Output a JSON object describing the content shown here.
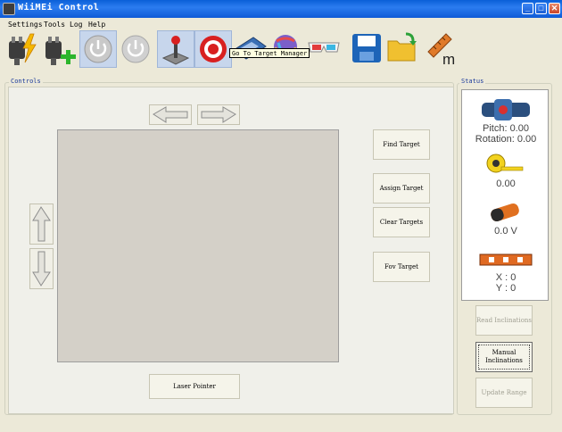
{
  "window": {
    "title": "WiiMEi Control",
    "minimize_glyph": "_",
    "maximize_glyph": "□",
    "close_glyph": "✕"
  },
  "menu": {
    "items": [
      {
        "label": "Settings"
      },
      {
        "label": "Tools"
      },
      {
        "label": "Log"
      },
      {
        "label": "Help"
      }
    ]
  },
  "toolbar": {
    "icons": [
      {
        "icon": "plug-disconnect-icon",
        "pressed": false
      },
      {
        "icon": "plug-connect-icon",
        "pressed": false
      },
      {
        "icon": "power-on-icon",
        "pressed": true
      },
      {
        "icon": "power-off-icon",
        "pressed": false
      },
      {
        "icon": "joystick-icon",
        "pressed": true
      },
      {
        "icon": "target-icon",
        "pressed": true
      },
      {
        "icon": "calculator-icon",
        "pressed": false
      },
      {
        "icon": "sphere-icon",
        "pressed": false
      },
      {
        "icon": "3d-glasses-icon",
        "pressed": false
      },
      {
        "icon": "save-icon",
        "pressed": false
      },
      {
        "icon": "open-folder-icon",
        "pressed": false
      },
      {
        "icon": "ruler-meters-icon",
        "pressed": false
      }
    ],
    "ruler_unit": "m",
    "tooltip": "Go To Target Manager"
  },
  "controls": {
    "group_label": "Controls",
    "find_target": "Find Target",
    "assign_target": "Assign Target",
    "clear_targets": "Clear Targets",
    "fov_target": "Fov Target",
    "laser_pointer": "Laser Pointer"
  },
  "status": {
    "group_label": "Status",
    "pitch": "Pitch: 0.00",
    "rotation": "Rotation: 0.00",
    "distance": "0.00",
    "voltage": "0.0 V",
    "x": "X : 0",
    "y": "Y : 0",
    "read_inclinations": "Read Inclinations",
    "manual_inclinations": "Manual Inclinations",
    "update_range": "Update Range"
  },
  "colors": {
    "titlebar": "#0a5fd8",
    "background": "#ece9d8",
    "panel": "#f0f0ea",
    "video": "#d4d0c8"
  }
}
